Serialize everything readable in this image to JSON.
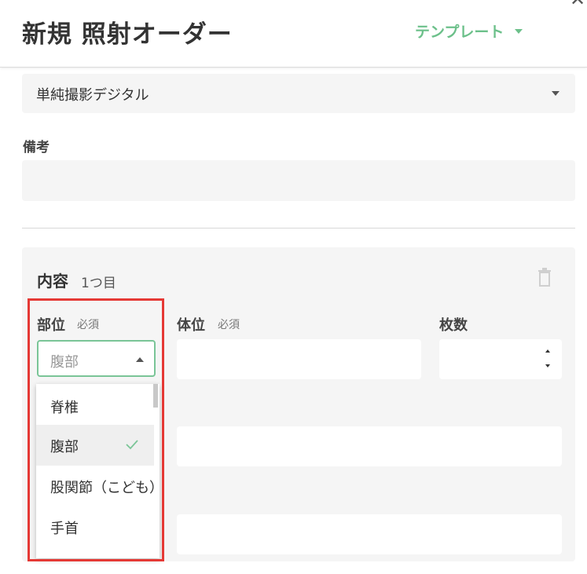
{
  "header": {
    "title": "新規 照射オーダー",
    "template_button": "テンプレート",
    "close_glyph": "✕"
  },
  "exam_type": {
    "value": "単純撮影デジタル"
  },
  "remarks": {
    "label": "備考",
    "value": ""
  },
  "content": {
    "title": "内容",
    "index_label": "1つ目",
    "fields": {
      "body_part": {
        "label": "部位",
        "required": "必須",
        "placeholder": "腹部"
      },
      "position": {
        "label": "体位",
        "required": "必須",
        "value": ""
      },
      "count": {
        "label": "枚数",
        "value": ""
      }
    },
    "body_part_options": [
      {
        "label": "脊椎",
        "selected": false
      },
      {
        "label": "腹部",
        "selected": true
      },
      {
        "label": "股関節（こども）",
        "selected": false
      },
      {
        "label": "手首",
        "selected": false
      }
    ]
  },
  "colors": {
    "accent": "#6cc08a",
    "highlight": "#e53935",
    "field_bg": "#f5f5f5"
  },
  "icons": [
    "close-icon",
    "caret-down-icon",
    "trash-icon",
    "caret-up-icon",
    "check-icon",
    "spin-up-icon",
    "spin-down-icon"
  ]
}
